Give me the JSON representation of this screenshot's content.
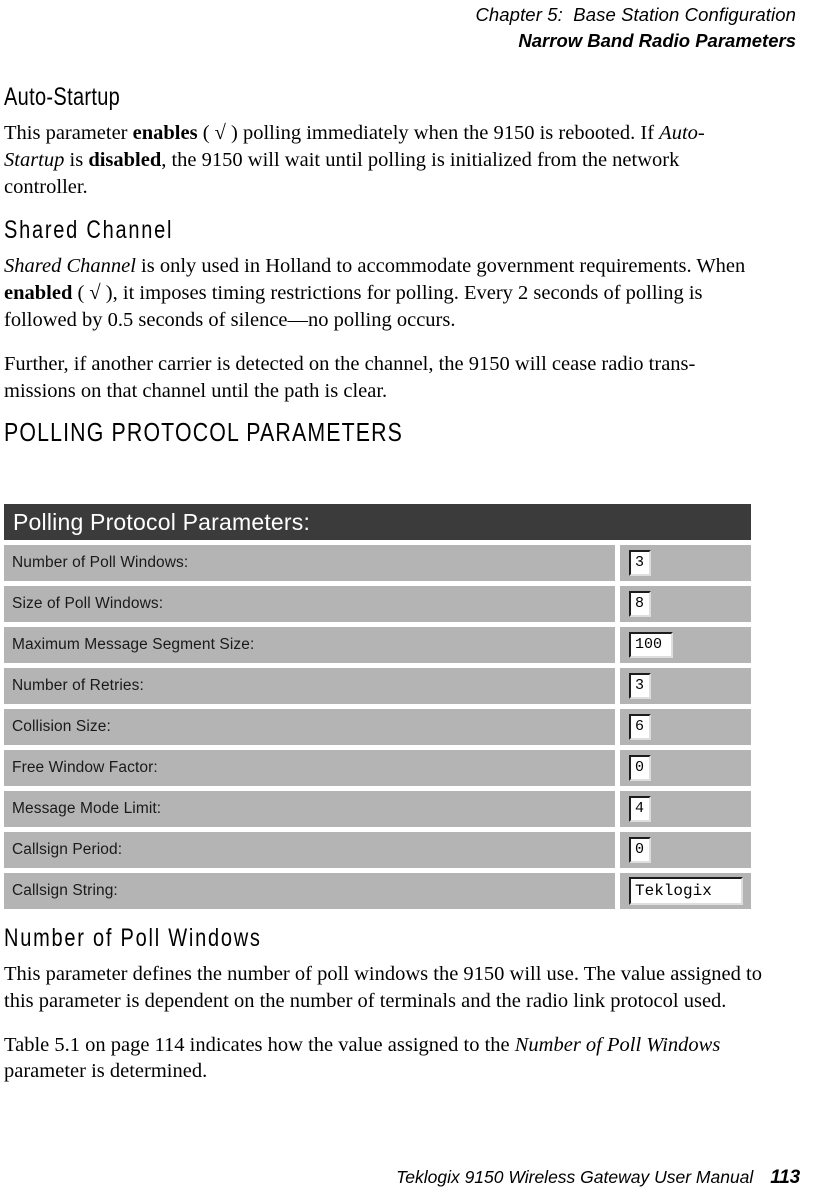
{
  "running_head": {
    "chapter": "Chapter 5:  Base Station Configuration",
    "subtitle": "Narrow Band Radio Parameters"
  },
  "sections": {
    "auto_startup": {
      "heading": "Auto-Startup",
      "para_1_a": "This parameter ",
      "para_1_b": "enables",
      "para_1_c": " ( √ ) polling immediately when the 9150 is rebooted. If ",
      "para_1_d": "Auto-Startup",
      "para_1_e": " is ",
      "para_1_f": "disabled",
      "para_1_g": ", the 9150 will wait until polling is initialized from the network controller."
    },
    "shared_channel": {
      "heading": "Shared Channel",
      "para_1_a": "Shared Channel",
      "para_1_b": " is only used in Holland to accommodate government requirements. When ",
      "para_1_c": "enabled",
      "para_1_d": " ( √ ), it imposes timing restrictions for polling. Every 2 seconds of polling is followed by 0.5 seconds of silence—no polling occurs.",
      "para_2": "Further, if another carrier is detected on the channel, the 9150 will cease radio trans-missions on that channel until the path is clear."
    },
    "polling_protocol": {
      "heading": "POLLING PROTOCOL PARAMETERS"
    },
    "number_of_poll_windows": {
      "heading": "Number of Poll Windows",
      "para_1": "This parameter defines the number of poll windows the 9150 will use. The value assigned to this parameter is dependent on the number of terminals and the radio link protocol used.",
      "para_2_a": "Table 5.1 on page 114 indicates how the value assigned to the ",
      "para_2_b": "Number of Poll Windows",
      "para_2_c": " parameter is determined."
    }
  },
  "screenshot": {
    "title": "Polling Protocol Parameters:",
    "colors": {
      "titlebar_bg": "#3b3b3b",
      "titlebar_text": "#ffffff",
      "row_bg": "#b4b4b4",
      "field_bg": "#ffffff"
    },
    "rows": [
      {
        "label": "Number of Poll Windows:",
        "value": "3",
        "field_size": "small"
      },
      {
        "label": "Size of Poll Windows:",
        "value": "8",
        "field_size": "small"
      },
      {
        "label": "Maximum Message Segment Size:",
        "value": "100",
        "field_size": "medium"
      },
      {
        "label": "Number of Retries:",
        "value": "3",
        "field_size": "small"
      },
      {
        "label": "Collision Size:",
        "value": "6",
        "field_size": "small"
      },
      {
        "label": "Free Window Factor:",
        "value": "0",
        "field_size": "small"
      },
      {
        "label": "Message Mode Limit:",
        "value": "4",
        "field_size": "small"
      },
      {
        "label": "Callsign Period:",
        "value": "0",
        "field_size": "small"
      },
      {
        "label": "Callsign String:",
        "value": "Teklogix",
        "field_size": "string"
      }
    ]
  },
  "footer": {
    "manual": "Teklogix 9150 Wireless Gateway User Manual",
    "page": "113"
  }
}
